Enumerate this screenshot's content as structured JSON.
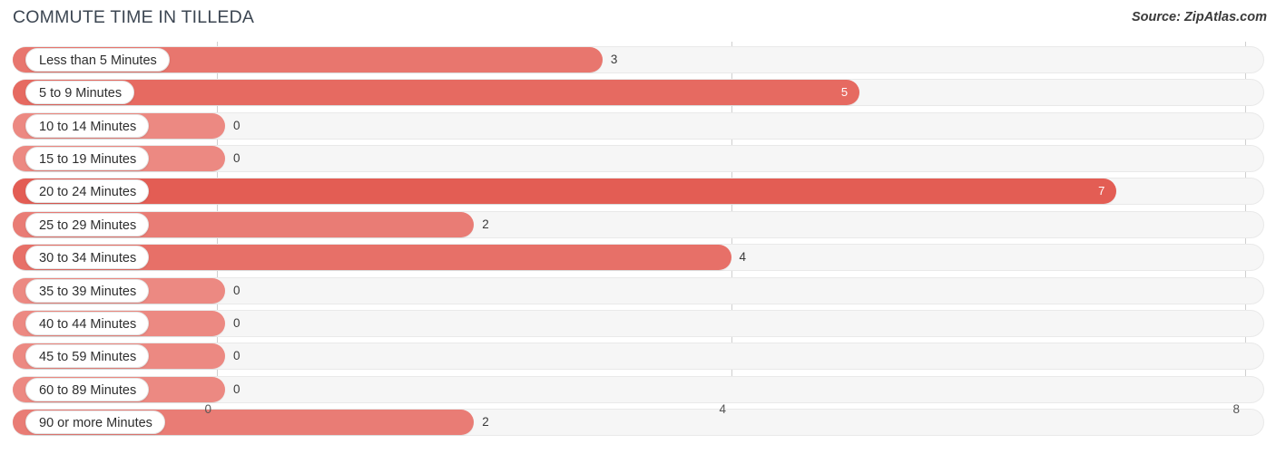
{
  "header": {
    "title": "COMMUTE TIME IN TILLEDA",
    "source": "Source: ZipAtlas.com"
  },
  "chart_data": {
    "type": "bar",
    "orientation": "horizontal",
    "title": "COMMUTE TIME IN TILLEDA",
    "xlabel": "",
    "ylabel": "",
    "xlim": [
      0,
      8
    ],
    "grid": true,
    "legend": null,
    "tick_labels": [
      "0",
      "4",
      "8"
    ],
    "ticks": [
      0,
      4,
      8
    ],
    "categories": [
      "Less than 5 Minutes",
      "5 to 9 Minutes",
      "10 to 14 Minutes",
      "15 to 19 Minutes",
      "20 to 24 Minutes",
      "25 to 29 Minutes",
      "30 to 34 Minutes",
      "35 to 39 Minutes",
      "40 to 44 Minutes",
      "45 to 59 Minutes",
      "60 to 89 Minutes",
      "90 or more Minutes"
    ],
    "values": [
      3,
      5,
      0,
      0,
      7,
      2,
      4,
      0,
      0,
      0,
      0,
      2
    ],
    "value_labels": [
      "3",
      "5",
      "0",
      "0",
      "7",
      "2",
      "4",
      "0",
      "0",
      "0",
      "0",
      "2"
    ],
    "colors": {
      "bar_max": "#e2574d",
      "bar_min": "#f2a8a4",
      "track": "#f6f6f6",
      "gridline": "#cfcfcf",
      "title": "#3c4652",
      "text": "#3a3a3a"
    }
  }
}
